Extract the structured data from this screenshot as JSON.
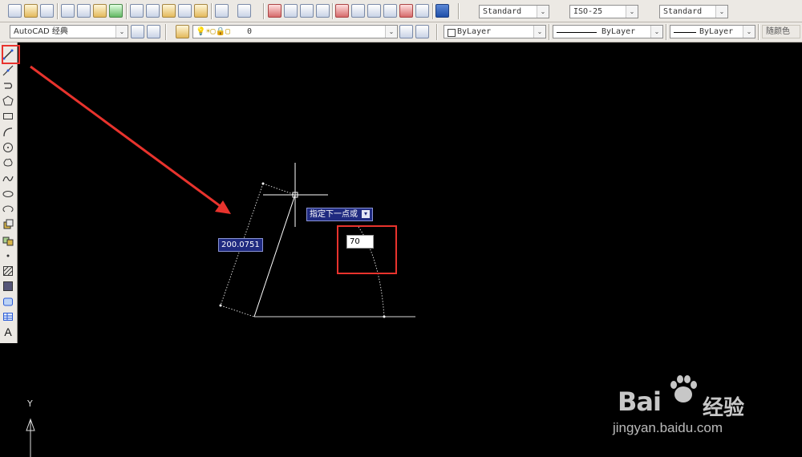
{
  "toolbar_top": {
    "text_style_value": "Standard",
    "dim_style_value": "ISO-25",
    "table_style_value": "Standard"
  },
  "toolbar_layers": {
    "workspace_value": "AutoCAD 经典",
    "layer_value": "0",
    "color_value": "ByLayer",
    "linetype_value": "ByLayer",
    "lineweight_value": "ByLayer",
    "plotstyle_value": "随颜色"
  },
  "drawing": {
    "length_value": "200.0751",
    "prompt_text": "指定下一点或",
    "angle_input_value": "70",
    "ucs_y_label": "Y"
  },
  "watermark": {
    "brand": "Bai",
    "brand_suffix": "经验",
    "url": "jingyan.baidu.com"
  },
  "colors": {
    "annotation_red": "#e8332d",
    "tooltip_bg": "#1f2a80",
    "canvas_bg": "#000000"
  }
}
